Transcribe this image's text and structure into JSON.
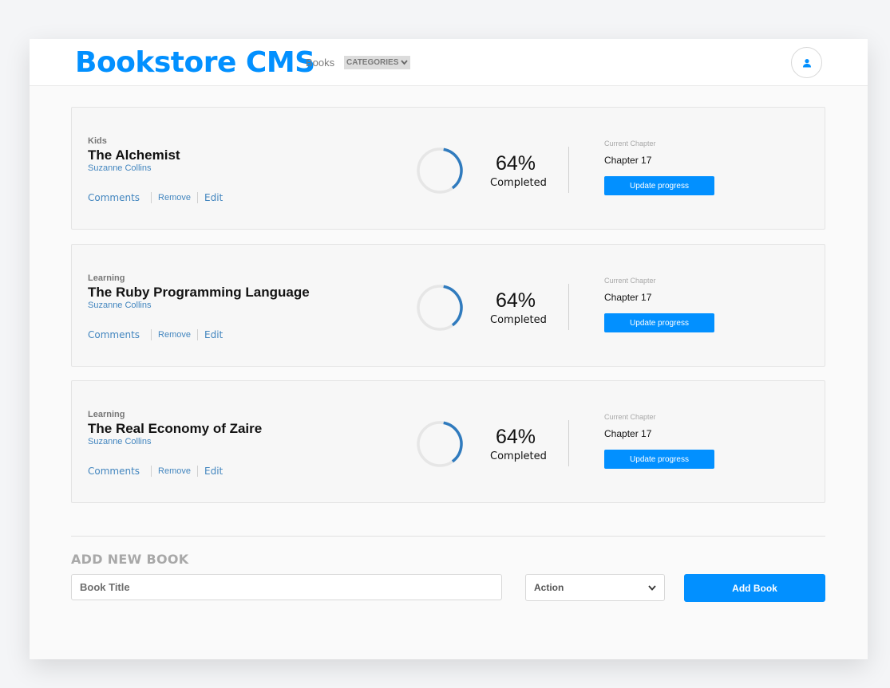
{
  "header": {
    "brand": "Bookstore CMS",
    "nav_books": "Books",
    "nav_categories": "CATEGORIES",
    "avatar_icon": "user-icon",
    "accent_color": "#0290ff"
  },
  "books": [
    {
      "genre": "Kids",
      "title": "The Alchemist",
      "author": "Suzanne Collins",
      "comments_label": "Comments",
      "remove_label": "Remove",
      "edit_label": "Edit",
      "progress_percent": 64,
      "percent_text": "64%",
      "completed_label": "Completed",
      "chapter_label": "Current Chapter",
      "chapter_value": "Chapter 17",
      "update_label": "Update progress"
    },
    {
      "genre": "Learning",
      "title": "The Ruby Programming Language",
      "author": "Suzanne Collins",
      "comments_label": "Comments",
      "remove_label": "Remove",
      "edit_label": "Edit",
      "progress_percent": 64,
      "percent_text": "64%",
      "completed_label": "Completed",
      "chapter_label": "Current Chapter",
      "chapter_value": "Chapter 17",
      "update_label": "Update progress"
    },
    {
      "genre": "Learning",
      "title": "The Real Economy of Zaire",
      "author": "Suzanne Collins",
      "comments_label": "Comments",
      "remove_label": "Remove",
      "edit_label": "Edit",
      "progress_percent": 64,
      "percent_text": "64%",
      "completed_label": "Completed",
      "chapter_label": "Current Chapter",
      "chapter_value": "Chapter 17",
      "update_label": "Update progress"
    }
  ],
  "add_book": {
    "heading": "ADD NEW BOOK",
    "title_placeholder": "Book Title",
    "title_value": "",
    "category_selected": "Action",
    "submit_label": "Add Book"
  }
}
